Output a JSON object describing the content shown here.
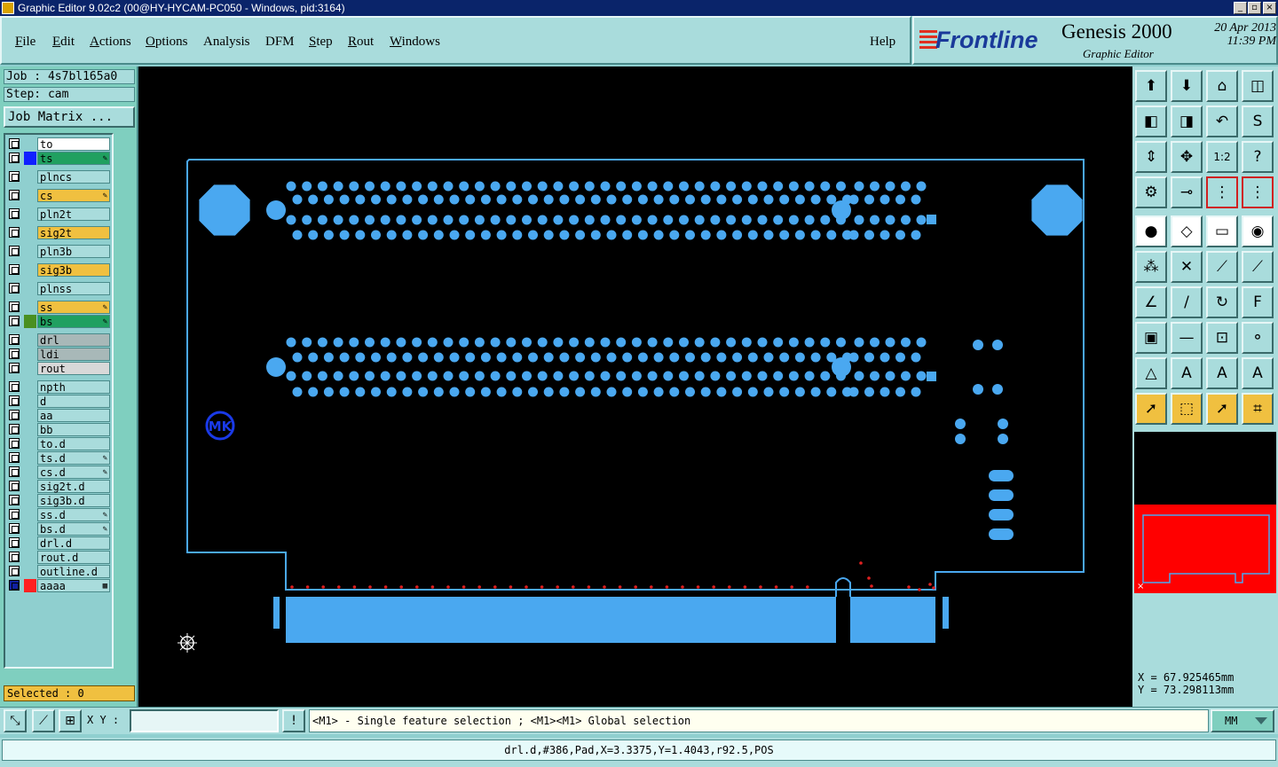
{
  "window": {
    "title": "Graphic Editor 9.02c2 (00@HY-HYCAM-PC050 - Windows, pid:3164)"
  },
  "menu": {
    "items": [
      {
        "pre": "",
        "ul": "F",
        "post": "ile"
      },
      {
        "pre": "",
        "ul": "E",
        "post": "dit"
      },
      {
        "pre": "",
        "ul": "A",
        "post": "ctions"
      },
      {
        "pre": "",
        "ul": "O",
        "post": "ptions"
      },
      {
        "pre": "",
        "ul": "",
        "post": "Analysis"
      },
      {
        "pre": "",
        "ul": "",
        "post": "DFM"
      },
      {
        "pre": "",
        "ul": "S",
        "post": "tep"
      },
      {
        "pre": "",
        "ul": "R",
        "post": "out"
      },
      {
        "pre": "",
        "ul": "W",
        "post": "indows"
      }
    ],
    "help": "Help"
  },
  "brand": {
    "logo": "Frontline",
    "product": "Genesis 2000",
    "subtitle": "Graphic Editor",
    "date": "20 Apr 2013",
    "time": "11:39 PM"
  },
  "job": {
    "job": "Job : 4s7bl165a0",
    "step": "Step: cam",
    "matrix_button": "Job Matrix ..."
  },
  "layers": [
    {
      "name": "to",
      "bg": "#ffffff",
      "sw": "",
      "mk": ""
    },
    {
      "name": "ts",
      "bg": "#20a060",
      "sw": "#1020ff",
      "mk": "✎"
    },
    {
      "name": "plncs",
      "bg": "#a9dcdc",
      "sw": "",
      "mk": ""
    },
    {
      "name": "cs",
      "bg": "#f0c040",
      "sw": "",
      "mk": "✎"
    },
    {
      "name": "pln2t",
      "bg": "#a9dcdc",
      "sw": "",
      "mk": ""
    },
    {
      "name": "sig2t",
      "bg": "#f0c040",
      "sw": "",
      "mk": ""
    },
    {
      "name": "pln3b",
      "bg": "#a9dcdc",
      "sw": "",
      "mk": ""
    },
    {
      "name": "sig3b",
      "bg": "#f0c040",
      "sw": "",
      "mk": ""
    },
    {
      "name": "plnss",
      "bg": "#a9dcdc",
      "sw": "",
      "mk": ""
    },
    {
      "name": "ss",
      "bg": "#f0c040",
      "sw": "",
      "mk": "✎"
    },
    {
      "name": "bs",
      "bg": "#20a060",
      "sw": "#4a9020",
      "mk": "✎"
    },
    {
      "name": "drl",
      "bg": "#a8b8b8",
      "sw": "",
      "mk": ""
    },
    {
      "name": "ldi",
      "bg": "#a8b8b8",
      "sw": "",
      "mk": ""
    },
    {
      "name": "rout",
      "bg": "#d8d8d8",
      "sw": "",
      "mk": ""
    },
    {
      "name": "npth",
      "bg": "#a9dcdc",
      "sw": "",
      "mk": ""
    },
    {
      "name": "d",
      "bg": "#a9dcdc",
      "sw": "",
      "mk": ""
    },
    {
      "name": "aa",
      "bg": "#a9dcdc",
      "sw": "",
      "mk": ""
    },
    {
      "name": "bb",
      "bg": "#a9dcdc",
      "sw": "",
      "mk": ""
    },
    {
      "name": "to.d",
      "bg": "#a9dcdc",
      "sw": "",
      "mk": ""
    },
    {
      "name": "ts.d",
      "bg": "#a9dcdc",
      "sw": "",
      "mk": "✎"
    },
    {
      "name": "cs.d",
      "bg": "#a9dcdc",
      "sw": "",
      "mk": "✎"
    },
    {
      "name": "sig2t.d",
      "bg": "#a9dcdc",
      "sw": "",
      "mk": ""
    },
    {
      "name": "sig3b.d",
      "bg": "#a9dcdc",
      "sw": "",
      "mk": ""
    },
    {
      "name": "ss.d",
      "bg": "#a9dcdc",
      "sw": "",
      "mk": "✎"
    },
    {
      "name": "bs.d",
      "bg": "#a9dcdc",
      "sw": "",
      "mk": "✎"
    },
    {
      "name": "drl.d",
      "bg": "#a9dcdc",
      "sw": "",
      "mk": ""
    },
    {
      "name": "rout.d",
      "bg": "#a9dcdc",
      "sw": "",
      "mk": ""
    },
    {
      "name": "outline.d",
      "bg": "#a9dcdc",
      "sw": "",
      "mk": ""
    },
    {
      "name": "aaaa",
      "bg": "#a9dcdc",
      "sw": "#ff2020",
      "mk": "▦"
    }
  ],
  "selected": "Selected : 0",
  "tools": [
    {
      "icon": "clipboard-up-icon",
      "g": "⬆",
      "style": ""
    },
    {
      "icon": "clipboard-down-icon",
      "g": "⬇",
      "style": ""
    },
    {
      "icon": "home-icon",
      "g": "⌂",
      "style": ""
    },
    {
      "icon": "split-view-icon",
      "g": "◫",
      "style": ""
    },
    {
      "icon": "pan-left-icon",
      "g": "◧",
      "style": ""
    },
    {
      "icon": "pan-right-icon",
      "g": "◨",
      "style": ""
    },
    {
      "icon": "zoom-back-icon",
      "g": "↶",
      "style": ""
    },
    {
      "icon": "redraw-icon",
      "g": "S",
      "style": ""
    },
    {
      "icon": "fit-vertical-icon",
      "g": "⇕",
      "style": ""
    },
    {
      "icon": "fit-all-icon",
      "g": "✥",
      "style": ""
    },
    {
      "icon": "scale-one-to-two-icon",
      "g": "1:2",
      "style": ""
    },
    {
      "icon": "help-query-icon",
      "g": "?",
      "style": ""
    },
    {
      "icon": "tools-config-icon",
      "g": "⚙",
      "style": ""
    },
    {
      "icon": "probe-icon",
      "g": "⊸",
      "style": ""
    },
    {
      "icon": "layer-stack-red-icon",
      "g": "⋮",
      "style": "red"
    },
    {
      "icon": "layer-stack-red-2-icon",
      "g": "⋮",
      "style": "red"
    },
    {
      "icon": "add-pad-icon",
      "g": "●",
      "style": "white"
    },
    {
      "icon": "add-shape-icon",
      "g": "◇",
      "style": "white"
    },
    {
      "icon": "ruler-icon",
      "g": "▭",
      "style": "white"
    },
    {
      "icon": "pad-select-icon",
      "g": "◉",
      "style": "white"
    },
    {
      "icon": "network-icon",
      "g": "⁂",
      "style": ""
    },
    {
      "icon": "cross-select-icon",
      "g": "✕",
      "style": ""
    },
    {
      "icon": "line-node-icon",
      "g": "⟋",
      "style": ""
    },
    {
      "icon": "line-node-2-icon",
      "g": "⟋",
      "style": ""
    },
    {
      "icon": "angle-icon",
      "g": "∠",
      "style": ""
    },
    {
      "icon": "slash-line-icon",
      "g": "/",
      "style": ""
    },
    {
      "icon": "arc-icon",
      "g": "↻",
      "style": ""
    },
    {
      "icon": "text-f-icon",
      "g": "F",
      "style": ""
    },
    {
      "icon": "pad-red-icon",
      "g": "▣",
      "style": ""
    },
    {
      "icon": "move-line-icon",
      "g": "—",
      "style": ""
    },
    {
      "icon": "measure-box-icon",
      "g": "⊡",
      "style": ""
    },
    {
      "icon": "circles-icon",
      "g": "⚬",
      "style": ""
    },
    {
      "icon": "triangle-a-icon",
      "g": "△",
      "style": ""
    },
    {
      "icon": "triangle-b-icon",
      "g": "A",
      "style": ""
    },
    {
      "icon": "triangle-c-icon",
      "g": "A",
      "style": ""
    },
    {
      "icon": "triangle-d-icon",
      "g": "A",
      "style": ""
    },
    {
      "icon": "pointer-select-icon",
      "g": "➚",
      "style": "orange"
    },
    {
      "icon": "pointer-box-icon",
      "g": "⬚",
      "style": "orange"
    },
    {
      "icon": "pointer-zoom-icon",
      "g": "➚",
      "style": "orange"
    },
    {
      "icon": "node-pointer-icon",
      "g": "⌗",
      "style": "orange"
    }
  ],
  "coords": {
    "x": "X =  67.925465mm",
    "y": "Y =  73.298113mm"
  },
  "bottom": {
    "xy_label": "X Y :",
    "xy_value": "",
    "prompt": "<M1> - Single feature selection ; <M1><M1> Global selection",
    "units": "MM"
  },
  "status": "drl.d,#386,Pad,X=3.3375,Y=1.4043,r92.5,POS",
  "colors": {
    "pcb_feature": "#4aa8f0",
    "drill_dot": "#e02020",
    "canvas_bg": "#000000"
  },
  "canvas": {
    "logo_text": "MK"
  }
}
